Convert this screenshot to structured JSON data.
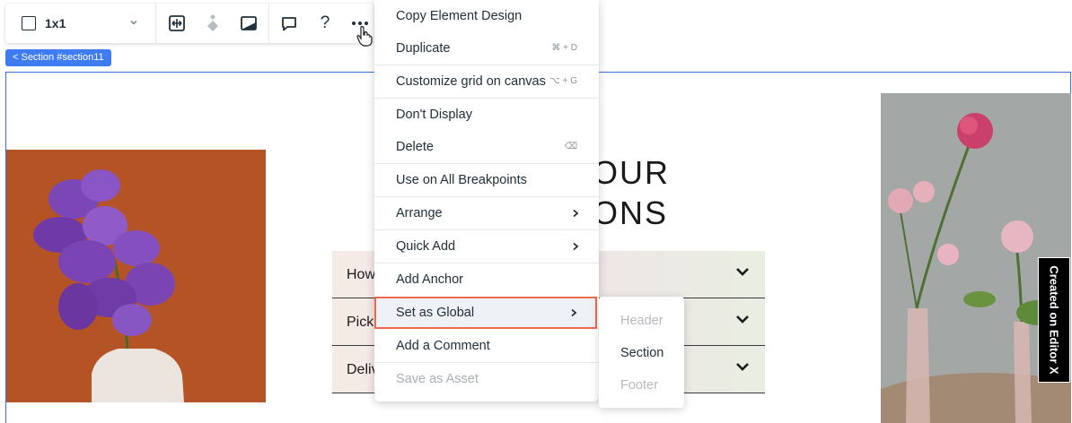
{
  "toolbar": {
    "layout_label": "1x1",
    "help_glyph": "?",
    "more_glyph": "•••",
    "icons": [
      "layout-square-icon",
      "chevron-down-icon",
      "stretch-icon",
      "anchor-diamond-icon",
      "background-icon",
      "comment-icon",
      "help-icon",
      "more-actions-icon"
    ]
  },
  "breadcrumb": {
    "label": "< Section #section11"
  },
  "canvas": {
    "heading_line1": "OUR",
    "heading_line2": "ONS",
    "faq": [
      {
        "question": "How"
      },
      {
        "question": "Pick"
      },
      {
        "question": "Deliv"
      }
    ]
  },
  "context_menu": {
    "items": [
      {
        "label": "Copy Element Design",
        "shortcut": ""
      },
      {
        "label": "Duplicate",
        "shortcut": "⌘ + D"
      },
      {
        "label": "Customize grid on canvas",
        "shortcut": "⌥ + G"
      },
      {
        "label": "Don't Display",
        "shortcut": ""
      },
      {
        "label": "Delete",
        "shortcut": "⌫"
      },
      {
        "label": "Use on All Breakpoints",
        "shortcut": ""
      },
      {
        "label": "Arrange",
        "shortcut": ""
      },
      {
        "label": "Quick Add",
        "shortcut": ""
      },
      {
        "label": "Add Anchor",
        "shortcut": ""
      },
      {
        "label": "Set as Global",
        "shortcut": ""
      },
      {
        "label": "Add a Comment",
        "shortcut": ""
      },
      {
        "label": "Save as Asset",
        "shortcut": ""
      }
    ],
    "highlight_color": "#ec6b4d"
  },
  "submenu": {
    "items": [
      {
        "label": "Header",
        "state": "disabled"
      },
      {
        "label": "Section",
        "state": "enabled"
      },
      {
        "label": "Footer",
        "state": "disabled"
      }
    ]
  },
  "badge": {
    "label": "Created on Editor X"
  },
  "colors": {
    "selection": "#3b6fe0",
    "breadcrumb_bg": "#3f7cf2",
    "orchid_bg": "#b45426"
  }
}
